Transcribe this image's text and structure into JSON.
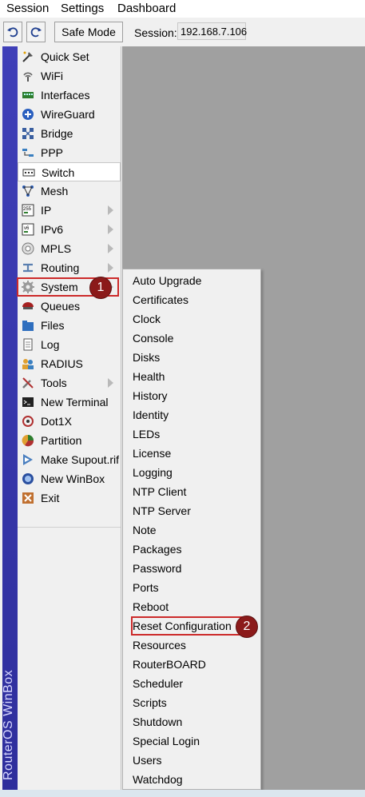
{
  "menubar": [
    "Session",
    "Settings",
    "Dashboard"
  ],
  "toolbar": {
    "undo_icon": "undo-icon",
    "redo_icon": "redo-icon",
    "safe_mode": "Safe Mode",
    "session_label": "Session:",
    "session_value": "192.168.7.106"
  },
  "brand": "RouterOS WinBox",
  "main_menu": [
    {
      "label": "Quick Set",
      "icon": "quick-set-icon",
      "submenu": false
    },
    {
      "label": "WiFi",
      "icon": "wifi-icon",
      "submenu": false
    },
    {
      "label": "Interfaces",
      "icon": "interfaces-icon",
      "submenu": false
    },
    {
      "label": "WireGuard",
      "icon": "wireguard-icon",
      "submenu": false
    },
    {
      "label": "Bridge",
      "icon": "bridge-icon",
      "submenu": false
    },
    {
      "label": "PPP",
      "icon": "ppp-icon",
      "submenu": false
    },
    {
      "label": "Switch",
      "icon": "switch-icon",
      "submenu": false
    },
    {
      "label": "Mesh",
      "icon": "mesh-icon",
      "submenu": false
    },
    {
      "label": "IP",
      "icon": "ip-icon",
      "submenu": true
    },
    {
      "label": "IPv6",
      "icon": "ipv6-icon",
      "submenu": true
    },
    {
      "label": "MPLS",
      "icon": "mpls-icon",
      "submenu": true
    },
    {
      "label": "Routing",
      "icon": "routing-icon",
      "submenu": true
    },
    {
      "label": "System",
      "icon": "system-gear-icon",
      "submenu": true
    },
    {
      "label": "Queues",
      "icon": "queues-icon",
      "submenu": false
    },
    {
      "label": "Files",
      "icon": "files-icon",
      "submenu": false
    },
    {
      "label": "Log",
      "icon": "log-icon",
      "submenu": false
    },
    {
      "label": "RADIUS",
      "icon": "radius-icon",
      "submenu": false
    },
    {
      "label": "Tools",
      "icon": "tools-icon",
      "submenu": true
    },
    {
      "label": "New Terminal",
      "icon": "terminal-icon",
      "submenu": false
    },
    {
      "label": "Dot1X",
      "icon": "dot1x-icon",
      "submenu": false
    },
    {
      "label": "Partition",
      "icon": "partition-icon",
      "submenu": false
    },
    {
      "label": "Make Supout.rif",
      "icon": "supout-icon",
      "submenu": false
    },
    {
      "label": "New WinBox",
      "icon": "winbox-icon",
      "submenu": false
    },
    {
      "label": "Exit",
      "icon": "exit-icon",
      "submenu": false
    }
  ],
  "system_submenu": [
    "Auto Upgrade",
    "Certificates",
    "Clock",
    "Console",
    "Disks",
    "Health",
    "History",
    "Identity",
    "LEDs",
    "License",
    "Logging",
    "NTP Client",
    "NTP Server",
    "Note",
    "Packages",
    "Password",
    "Ports",
    "Reboot",
    "Reset Configuration",
    "Resources",
    "RouterBOARD",
    "Scheduler",
    "Scripts",
    "Shutdown",
    "Special Login",
    "Users",
    "Watchdog"
  ],
  "annotations": [
    {
      "number": "1",
      "target": "System"
    },
    {
      "number": "2",
      "target": "Reset Configuration"
    }
  ],
  "colors": {
    "brand_stripe": "#2e2e9c",
    "annotation_red": "#cc2a2a",
    "badge_fill": "#8b1a1a",
    "workarea": "#a0a0a0"
  }
}
